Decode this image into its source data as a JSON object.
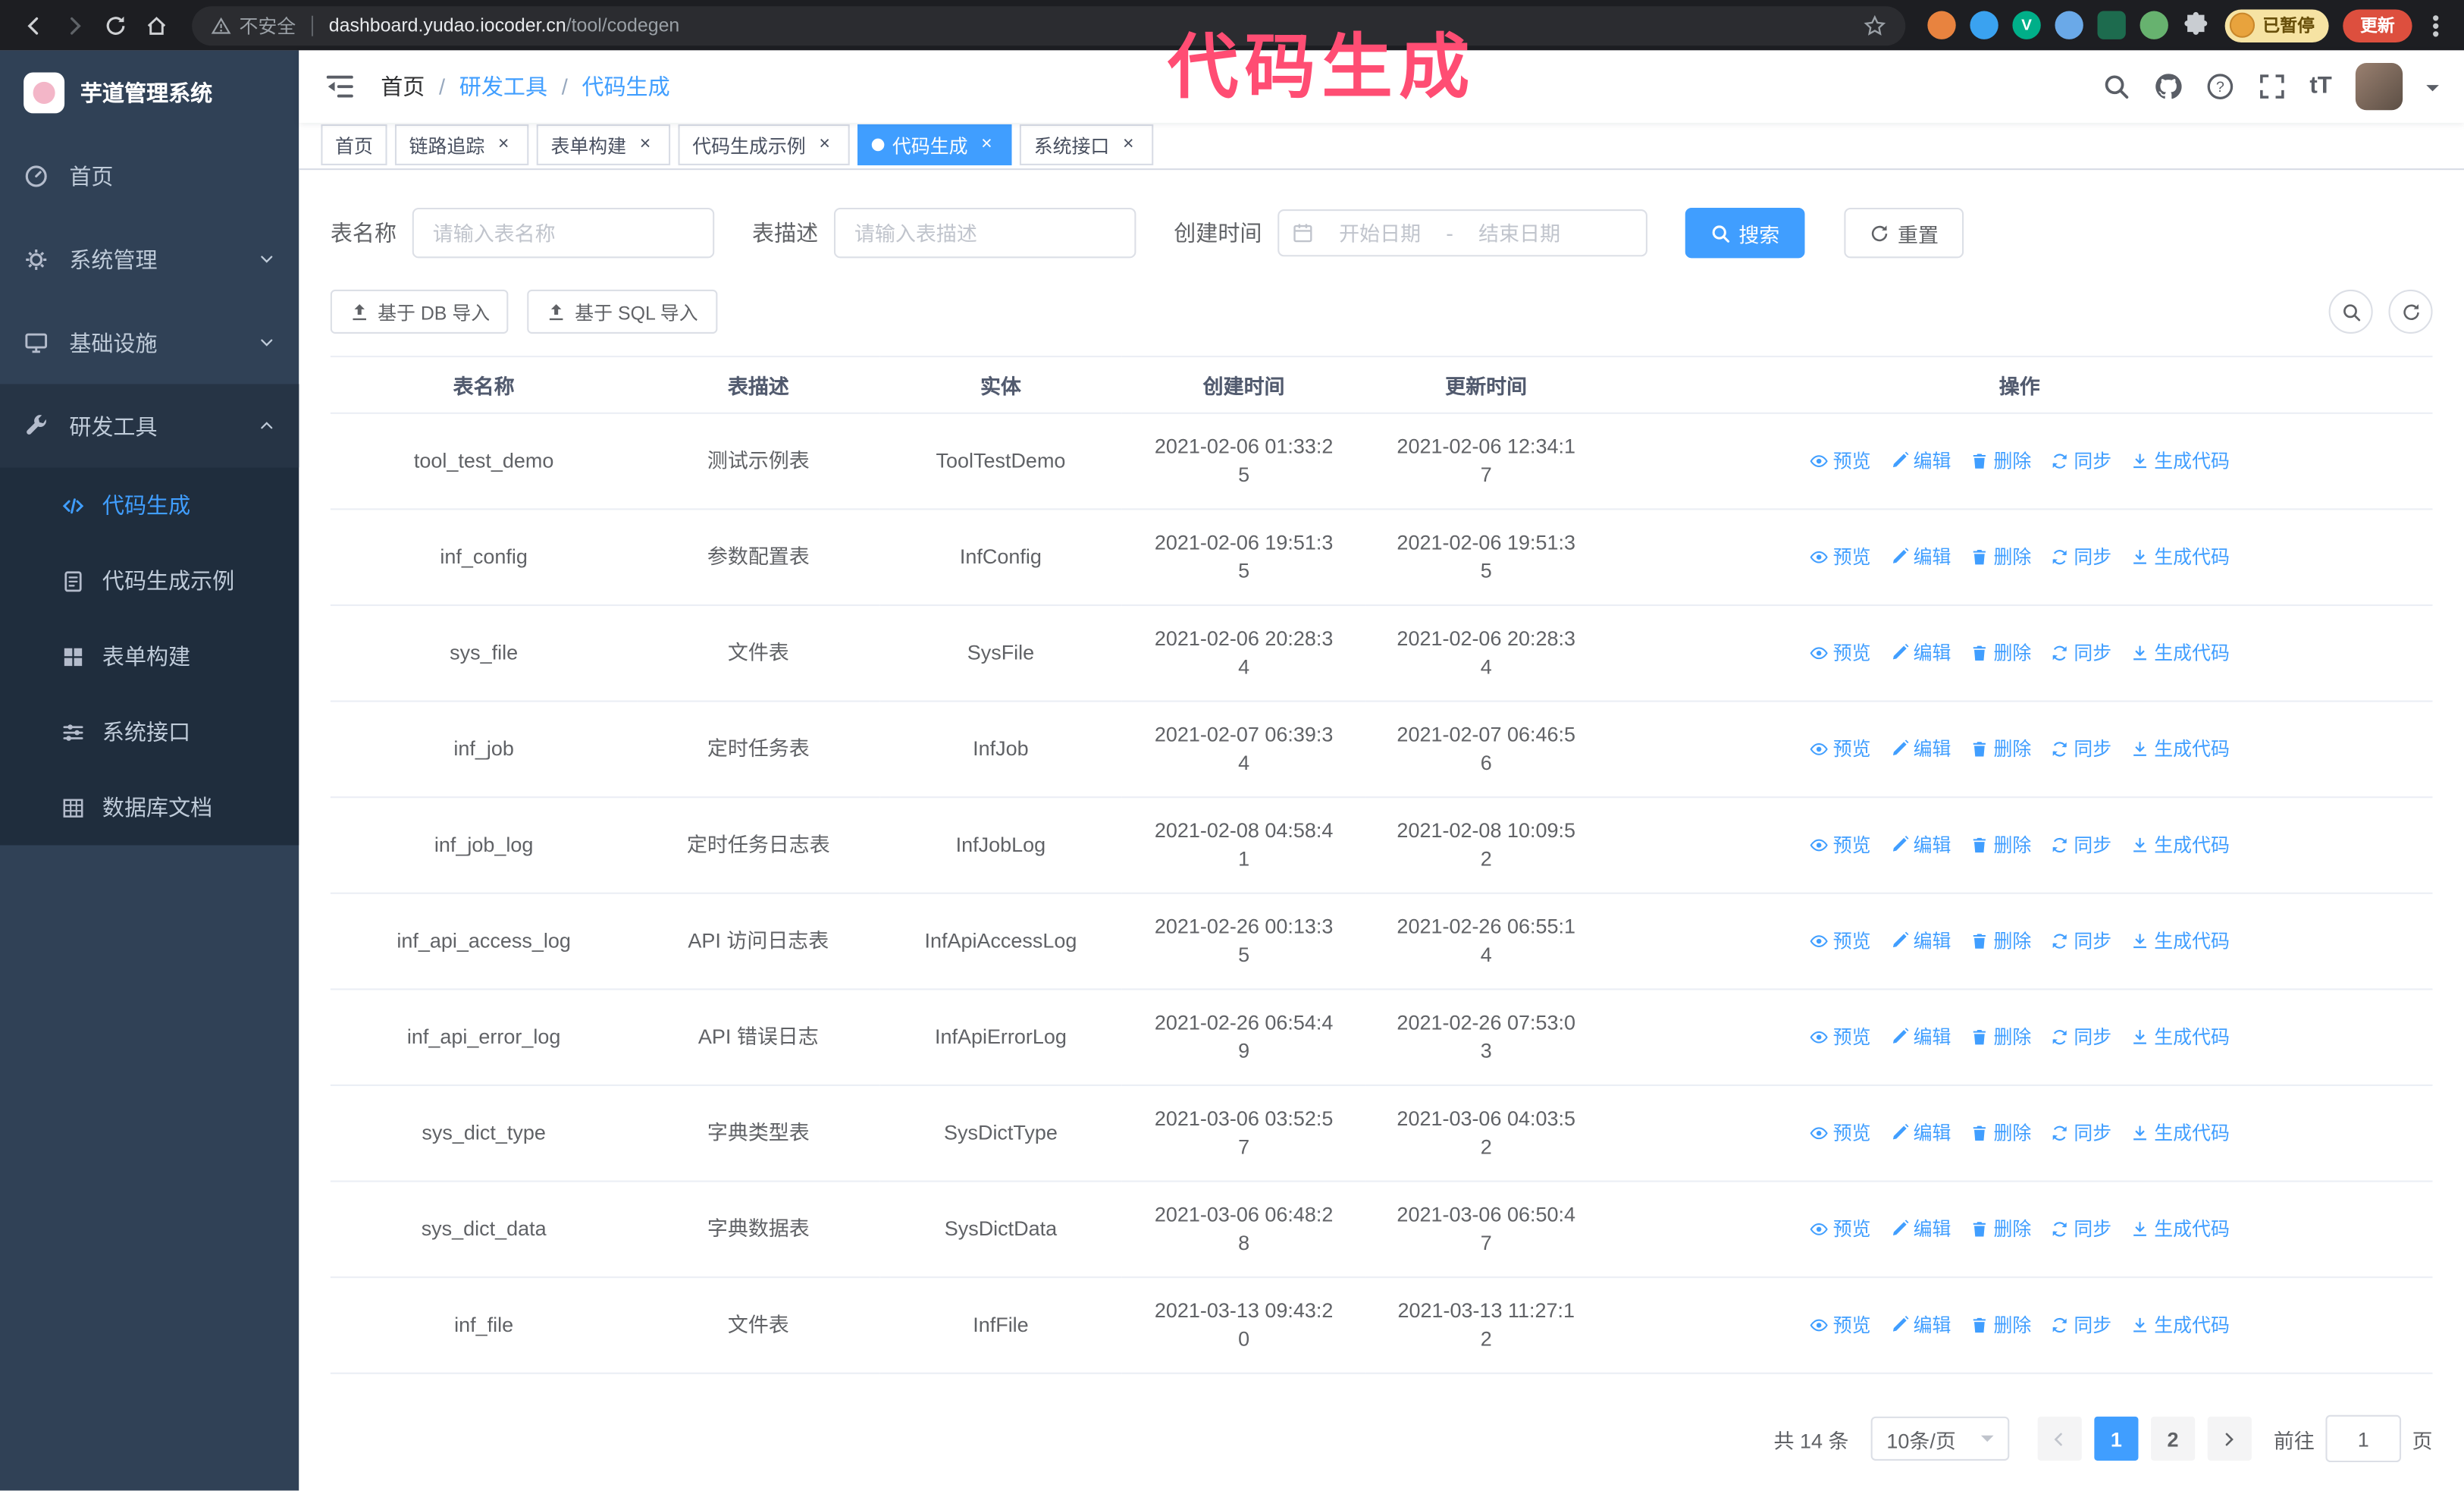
{
  "colors": {
    "accent_blue": "#409eff",
    "sidebar_bg": "#304156",
    "submenu_bg": "#1f2d3d",
    "annotation_pink": "#ff4d73",
    "update_button_bg": "#dd4f3e",
    "paused_badge_bg": "#f6e3a3",
    "table_border": "#ebeef5"
  },
  "browser": {
    "security_warning": "不安全",
    "url_domain": "dashboard.yudao.iocoder.cn",
    "url_path": "/tool/codegen",
    "paused_badge": "已暂停",
    "update_button": "更新",
    "nav_icons": [
      "back-icon",
      "forward-icon",
      "reload-icon",
      "home-icon",
      "warning-icon",
      "bookmark-star-icon",
      "extensions-puzzle-icon",
      "kebab-menu-icon"
    ]
  },
  "annotation": {
    "text": "代码生成"
  },
  "sidebar": {
    "logo_title": "芋道管理系统",
    "menu": [
      {
        "id": "home",
        "label": "首页",
        "icon": "dashboard-icon",
        "type": "item",
        "state": "none"
      },
      {
        "id": "system",
        "label": "系统管理",
        "icon": "gear-icon",
        "type": "group",
        "state": "collapsed"
      },
      {
        "id": "infra",
        "label": "基础设施",
        "icon": "infrastructure-icon",
        "type": "group",
        "state": "collapsed"
      },
      {
        "id": "devtools",
        "label": "研发工具",
        "icon": "tools-icon",
        "type": "group",
        "state": "expanded"
      }
    ],
    "submenu": [
      {
        "id": "codegen",
        "label": "代码生成",
        "icon": "code-icon",
        "active": true
      },
      {
        "id": "codegen-example",
        "label": "代码生成示例",
        "icon": "example-icon",
        "active": false
      },
      {
        "id": "form-builder",
        "label": "表单构建",
        "icon": "form-icon",
        "active": false
      },
      {
        "id": "api",
        "label": "系统接口",
        "icon": "api-icon",
        "active": false
      },
      {
        "id": "db-doc",
        "label": "数据库文档",
        "icon": "database-icon",
        "active": false
      }
    ]
  },
  "topbar": {
    "breadcrumb": [
      {
        "label": "首页",
        "current": false
      },
      {
        "label": "研发工具",
        "current": false
      },
      {
        "label": "代码生成",
        "current": true
      }
    ],
    "tool_icons": [
      "search-icon",
      "github-icon",
      "help-icon",
      "fullscreen-icon",
      "font-size-icon",
      "user-avatar",
      "caret-down-icon"
    ],
    "font_size_glyph": "tT"
  },
  "tags": [
    {
      "id": "home",
      "label": "首页",
      "closable": false,
      "active": false
    },
    {
      "id": "trace",
      "label": "链路追踪",
      "closable": true,
      "active": false
    },
    {
      "id": "form-builder",
      "label": "表单构建",
      "closable": true,
      "active": false
    },
    {
      "id": "codegen-example",
      "label": "代码生成示例",
      "closable": true,
      "active": false
    },
    {
      "id": "codegen",
      "label": "代码生成",
      "closable": true,
      "active": true
    },
    {
      "id": "api",
      "label": "系统接口",
      "closable": true,
      "active": false
    }
  ],
  "filters": {
    "table_name_label": "表名称",
    "table_name_placeholder": "请输入表名称",
    "table_desc_label": "表描述",
    "table_desc_placeholder": "请输入表描述",
    "create_time_label": "创建时间",
    "date_start_placeholder": "开始日期",
    "date_separator": "-",
    "date_end_placeholder": "结束日期",
    "search_button": "搜索",
    "reset_button": "重置"
  },
  "toolbar": {
    "import_db_button": "基于 DB 导入",
    "import_sql_button": "基于 SQL 导入"
  },
  "table": {
    "columns": [
      "表名称",
      "表描述",
      "实体",
      "创建时间",
      "更新时间",
      "操作"
    ],
    "row_actions": [
      {
        "id": "preview",
        "label": "预览",
        "icon": "eye-icon"
      },
      {
        "id": "edit",
        "label": "编辑",
        "icon": "edit-icon"
      },
      {
        "id": "delete",
        "label": "删除",
        "icon": "delete-icon"
      },
      {
        "id": "sync",
        "label": "同步",
        "icon": "sync-icon"
      },
      {
        "id": "generate",
        "label": "生成代码",
        "icon": "generate-code-icon"
      }
    ],
    "rows": [
      {
        "name": "tool_test_demo",
        "desc": "测试示例表",
        "entity": "ToolTestDemo",
        "created": "2021-02-06 01:33:25",
        "updated": "2021-02-06 12:34:17"
      },
      {
        "name": "inf_config",
        "desc": "参数配置表",
        "entity": "InfConfig",
        "created": "2021-02-06 19:51:35",
        "updated": "2021-02-06 19:51:35"
      },
      {
        "name": "sys_file",
        "desc": "文件表",
        "entity": "SysFile",
        "created": "2021-02-06 20:28:34",
        "updated": "2021-02-06 20:28:34"
      },
      {
        "name": "inf_job",
        "desc": "定时任务表",
        "entity": "InfJob",
        "created": "2021-02-07 06:39:34",
        "updated": "2021-02-07 06:46:56"
      },
      {
        "name": "inf_job_log",
        "desc": "定时任务日志表",
        "entity": "InfJobLog",
        "created": "2021-02-08 04:58:41",
        "updated": "2021-02-08 10:09:52"
      },
      {
        "name": "inf_api_access_log",
        "desc": "API 访问日志表",
        "entity": "InfApiAccessLog",
        "created": "2021-02-26 00:13:35",
        "updated": "2021-02-26 06:55:14"
      },
      {
        "name": "inf_api_error_log",
        "desc": "API 错误日志",
        "entity": "InfApiErrorLog",
        "created": "2021-02-26 06:54:49",
        "updated": "2021-02-26 07:53:03"
      },
      {
        "name": "sys_dict_type",
        "desc": "字典类型表",
        "entity": "SysDictType",
        "created": "2021-03-06 03:52:57",
        "updated": "2021-03-06 04:03:52"
      },
      {
        "name": "sys_dict_data",
        "desc": "字典数据表",
        "entity": "SysDictData",
        "created": "2021-03-06 06:48:28",
        "updated": "2021-03-06 06:50:47"
      },
      {
        "name": "inf_file",
        "desc": "文件表",
        "entity": "InfFile",
        "created": "2021-03-13 09:43:20",
        "updated": "2021-03-13 11:27:12"
      }
    ]
  },
  "pagination": {
    "total_text": "共 14 条",
    "page_size_text": "10条/页",
    "pages": [
      "1",
      "2"
    ],
    "active_page": "1",
    "goto_prefix": "前往",
    "goto_value": "1",
    "goto_suffix": "页"
  }
}
